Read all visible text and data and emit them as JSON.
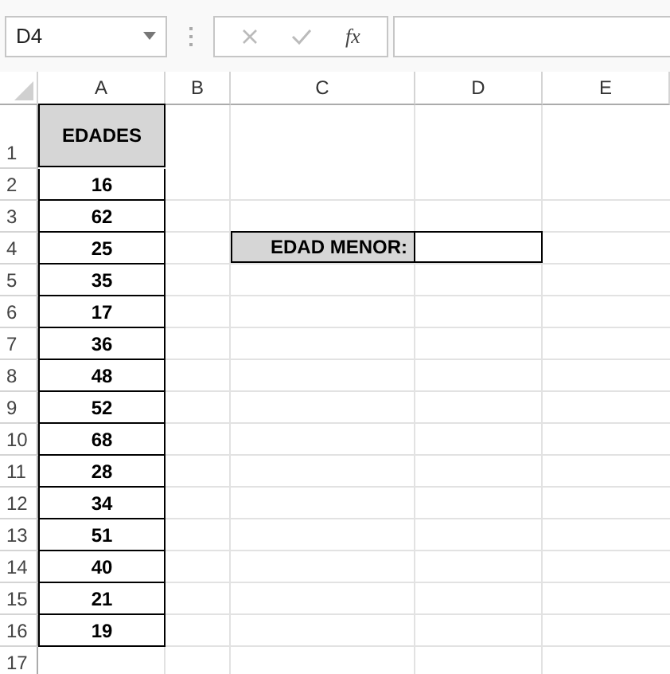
{
  "name_box": {
    "value": "D4"
  },
  "formula_bar": {
    "function_label": "fx"
  },
  "columns": [
    "A",
    "B",
    "C",
    "D",
    "E"
  ],
  "rows": [
    "1",
    "2",
    "3",
    "4",
    "5",
    "6",
    "7",
    "8",
    "9",
    "10",
    "11",
    "12",
    "13",
    "14",
    "15",
    "16",
    "17"
  ],
  "ages_table": {
    "header": "EDADES",
    "values": [
      "16",
      "62",
      "25",
      "35",
      "17",
      "36",
      "48",
      "52",
      "68",
      "28",
      "34",
      "51",
      "40",
      "21",
      "19"
    ]
  },
  "lookup": {
    "label": "EDAD MENOR:"
  }
}
